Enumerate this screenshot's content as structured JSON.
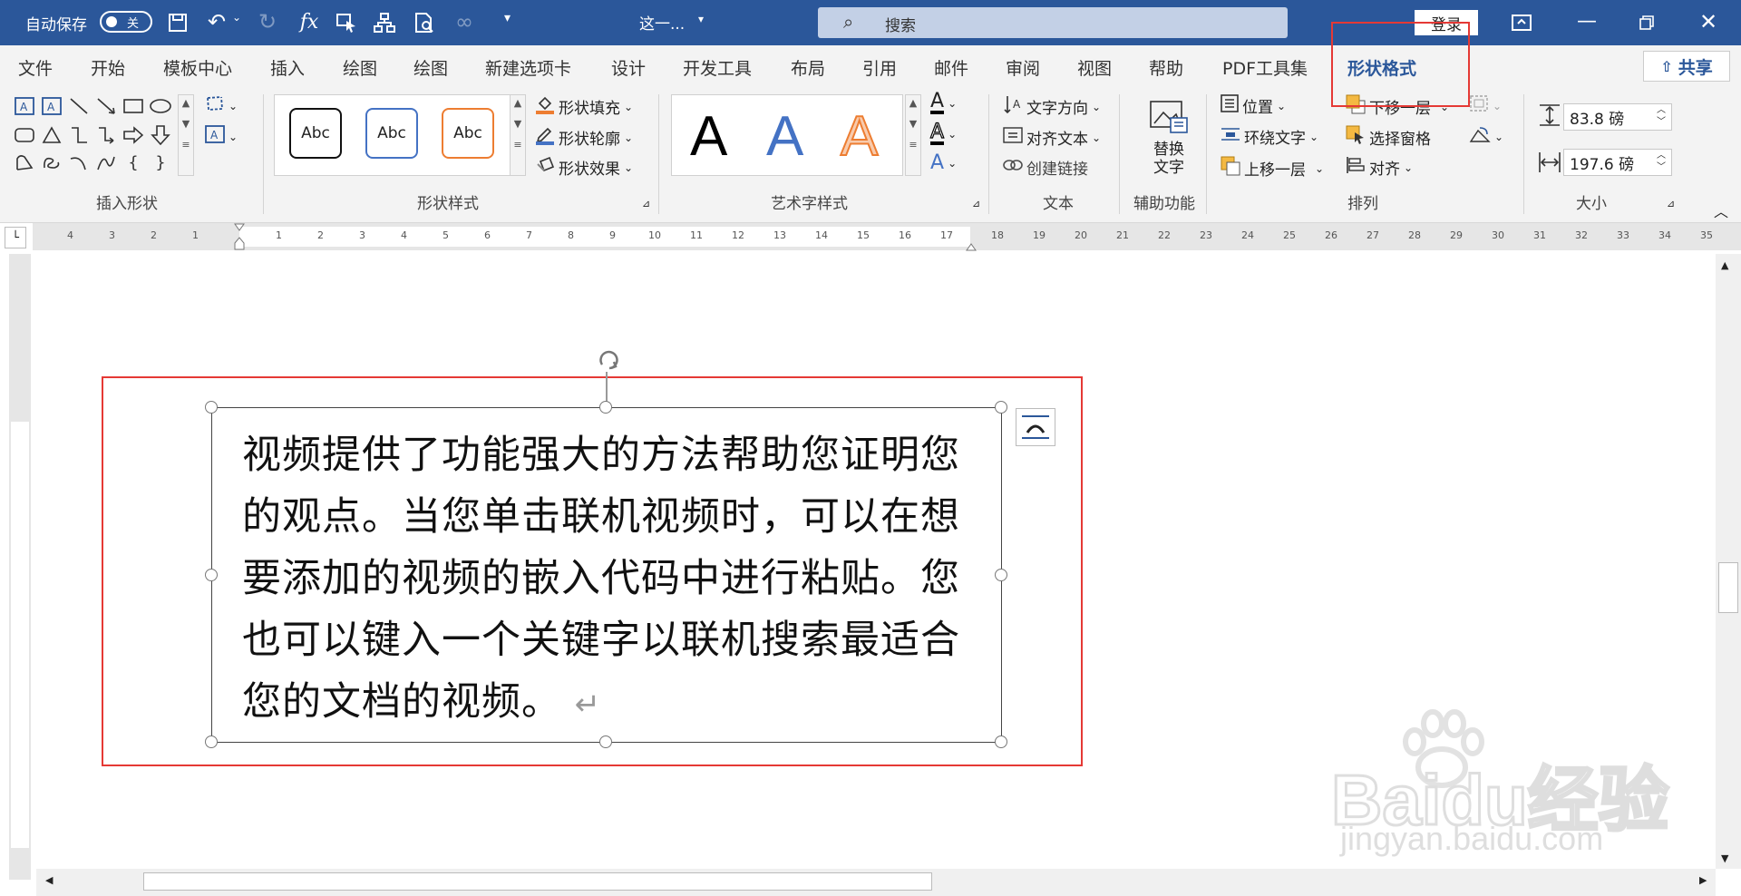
{
  "titlebar": {
    "autosave_label": "自动保存",
    "autosave_state": "关",
    "doc_title": "这一...",
    "search_placeholder": "搜索",
    "login_label": "登录"
  },
  "tabs": [
    "文件",
    "开始",
    "模板中心",
    "插入",
    "绘图",
    "绘图",
    "新建选项卡",
    "设计",
    "开发工具",
    "布局",
    "引用",
    "邮件",
    "审阅",
    "视图",
    "帮助",
    "PDF工具集",
    "形状格式"
  ],
  "active_tab": "形状格式",
  "share_label": "共享",
  "ribbon": {
    "groups": {
      "insert_shapes": "插入形状",
      "shape_styles": "形状样式",
      "wordart_styles": "艺术字样式",
      "text": "文本",
      "accessibility": "辅助功能",
      "arrange": "排列",
      "size": "大小"
    },
    "style_samples": [
      "Abc",
      "Abc",
      "Abc"
    ],
    "shape_fill": "形状填充",
    "shape_outline": "形状轮廓",
    "shape_effects": "形状效果",
    "art_samples": [
      "A",
      "A",
      "A"
    ],
    "text_direction": "文字方向",
    "align_text": "对齐文本",
    "create_link": "创建链接",
    "alt_text": "替换文字",
    "position": "位置",
    "wrap_text": "环绕文字",
    "bring_forward": "上移一层",
    "send_backward": "下移一层",
    "selection_pane": "选择窗格",
    "align": "对齐",
    "height": "83.8 磅",
    "width": "197.6 磅"
  },
  "ruler_h": [
    "4",
    "3",
    "2",
    "1",
    "1",
    "2",
    "3",
    "4",
    "5",
    "6",
    "7",
    "8",
    "9",
    "10",
    "11",
    "12",
    "13",
    "14",
    "15",
    "16",
    "17",
    "18",
    "19",
    "20",
    "21",
    "22",
    "23",
    "24",
    "25",
    "26",
    "27",
    "28",
    "29",
    "30",
    "31",
    "32",
    "33",
    "34",
    "35"
  ],
  "document": {
    "textbox_text": "视频提供了功能强大的方法帮助您证明您的观点。当您单击联机视频时，可以在想要添加的视频的嵌入代码中进行粘贴。您也可以键入一个关键字以联机搜索最适合您的文档的视频。",
    "paragraph_mark": "↵"
  },
  "watermark": {
    "logo": "Baidu经验",
    "url": "jingyan.baidu.com"
  },
  "colors": {
    "accent": "#2b579a",
    "highlight_red": "#e53935"
  }
}
